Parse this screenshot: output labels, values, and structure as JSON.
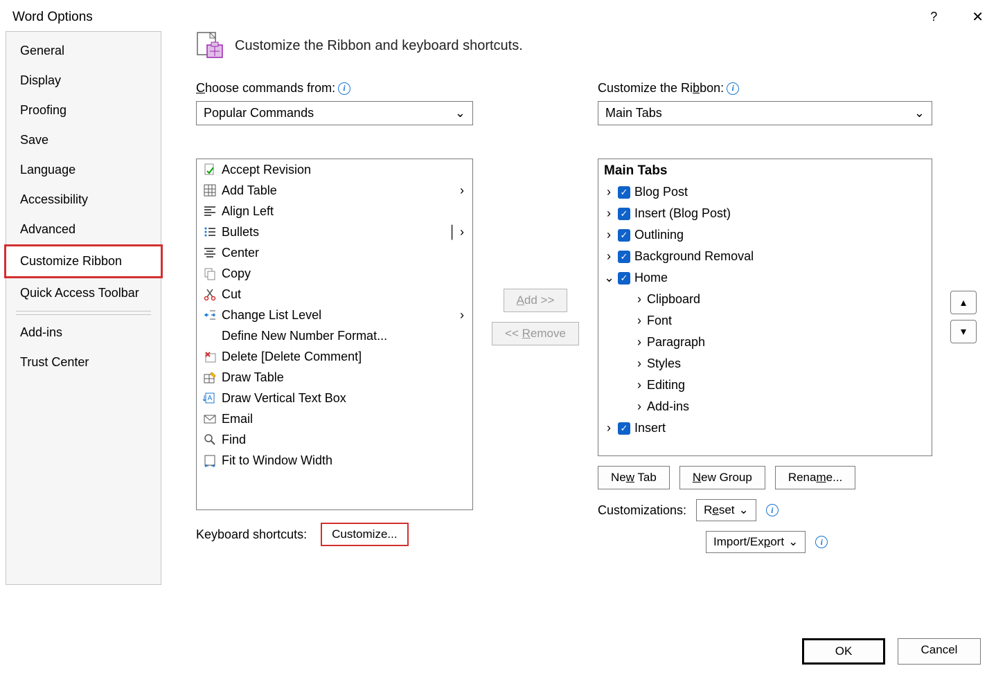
{
  "title": "Word Options",
  "sidebar": {
    "items": [
      "General",
      "Display",
      "Proofing",
      "Save",
      "Language",
      "Accessibility",
      "Advanced",
      "Customize Ribbon",
      "Quick Access Toolbar",
      "Add-ins",
      "Trust Center"
    ],
    "selected": 7
  },
  "main": {
    "header": "Customize the Ribbon and keyboard shortcuts.",
    "left_label": "Choose commands from:",
    "left_select": "Popular Commands",
    "commands": [
      {
        "icon": "accept",
        "label": "Accept Revision"
      },
      {
        "icon": "table",
        "label": "Add Table",
        "sub": true
      },
      {
        "icon": "alignleft",
        "label": "Align Left"
      },
      {
        "icon": "bullets",
        "label": "Bullets",
        "sub": true,
        "split": true
      },
      {
        "icon": "center",
        "label": "Center"
      },
      {
        "icon": "copy",
        "label": "Copy"
      },
      {
        "icon": "cut",
        "label": "Cut"
      },
      {
        "icon": "listlevel",
        "label": "Change List Level",
        "sub": true
      },
      {
        "icon": "",
        "label": "Define New Number Format..."
      },
      {
        "icon": "delete",
        "label": "Delete [Delete Comment]"
      },
      {
        "icon": "drawtable",
        "label": "Draw Table"
      },
      {
        "icon": "vtext",
        "label": "Draw Vertical Text Box"
      },
      {
        "icon": "email",
        "label": "Email"
      },
      {
        "icon": "find",
        "label": "Find"
      },
      {
        "icon": "fit",
        "label": "Fit to Window Width"
      }
    ],
    "add_btn": "Add >>",
    "remove_btn": "<< Remove",
    "right_label": "Customize the Ribbon:",
    "right_select": "Main Tabs",
    "tree_header": "Main Tabs",
    "tree": [
      {
        "label": "Blog Post",
        "checked": true,
        "expanded": false
      },
      {
        "label": "Insert (Blog Post)",
        "checked": true,
        "expanded": false
      },
      {
        "label": "Outlining",
        "checked": true,
        "expanded": false
      },
      {
        "label": "Background Removal",
        "checked": true,
        "expanded": false
      },
      {
        "label": "Home",
        "checked": true,
        "expanded": true,
        "children": [
          "Clipboard",
          "Font",
          "Paragraph",
          "Styles",
          "Editing",
          "Add-ins"
        ]
      },
      {
        "label": "Insert",
        "checked": true,
        "expanded": false
      }
    ],
    "new_tab": "New Tab",
    "new_group": "New Group",
    "rename": "Rename...",
    "customizations_label": "Customizations:",
    "reset": "Reset",
    "import_export": "Import/Export",
    "kb_label": "Keyboard shortcuts:",
    "customize_btn": "Customize..."
  },
  "footer": {
    "ok": "OK",
    "cancel": "Cancel"
  }
}
